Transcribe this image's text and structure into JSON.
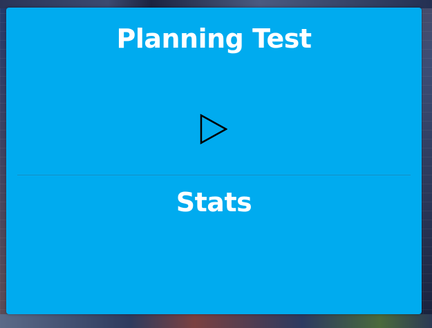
{
  "card": {
    "title": "Planning Test",
    "play_icon": "play-icon",
    "stats_label": "Stats"
  },
  "colors": {
    "panel_background": "#00abef",
    "text": "#ffffff",
    "icon_stroke": "#000000"
  }
}
